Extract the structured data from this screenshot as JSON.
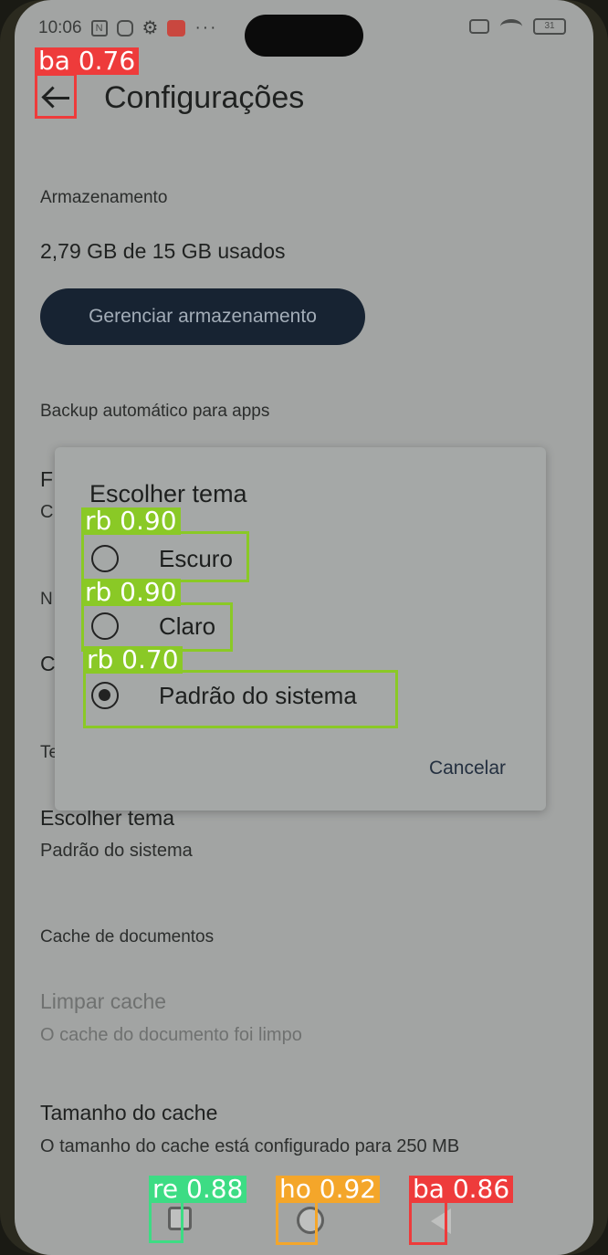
{
  "status_bar": {
    "time": "10:06",
    "icons": [
      "nfc-icon",
      "sim-icon",
      "gear-icon",
      "mail-icon",
      "more-dots-icon",
      "signal-off-icon",
      "wifi-icon",
      "battery-icon"
    ],
    "battery": "31"
  },
  "header": {
    "title": "Configurações",
    "back_icon": "arrow-back-icon"
  },
  "storage": {
    "section": "Armazenamento",
    "usage": "2,79 GB de 15 GB usados",
    "manage_button": "Gerenciar armazenamento"
  },
  "backup": {
    "section": "Backup automático para apps",
    "partial_initials": [
      "F",
      "C",
      "N",
      "C",
      "Te"
    ]
  },
  "theme": {
    "title": "Escolher tema",
    "value": "Padrão do sistema"
  },
  "cache": {
    "section": "Cache de documentos",
    "clear_title": "Limpar cache",
    "clear_subtitle": "O cache do documento foi limpo",
    "size_title": "Tamanho do cache",
    "size_subtitle": "O tamanho do cache está configurado para 250 MB"
  },
  "dialog": {
    "title": "Escolher tema",
    "options": [
      {
        "label": "Escuro",
        "checked": false
      },
      {
        "label": "Claro",
        "checked": false
      },
      {
        "label": "Padrão do sistema",
        "checked": true
      }
    ],
    "cancel": "Cancelar"
  },
  "annotations": [
    {
      "label": "ba 0.76",
      "color": "#ee3b3b"
    },
    {
      "label": "rb 0.90",
      "color": "#8ac926"
    },
    {
      "label": "rb 0.90",
      "color": "#8ac926"
    },
    {
      "label": "rb 0.70",
      "color": "#8ac926"
    },
    {
      "label": "re 0.88",
      "color": "#3ddc84"
    },
    {
      "label": "ho 0.92",
      "color": "#f4a62a"
    },
    {
      "label": "ba 0.86",
      "color": "#ee3b3b"
    }
  ],
  "nav": {
    "recent_icon": "square-icon",
    "home_icon": "circle-icon",
    "back_icon": "triangle-back-icon"
  }
}
